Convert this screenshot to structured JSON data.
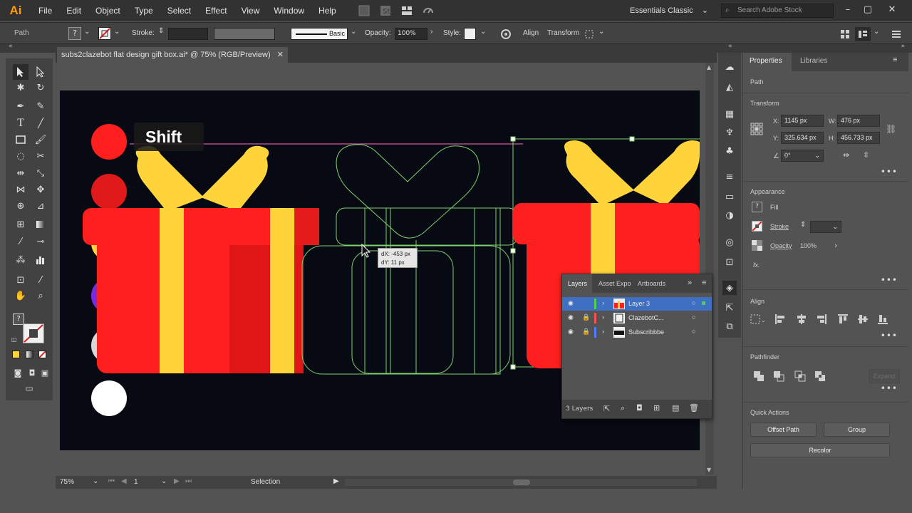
{
  "app": {
    "logo": "Ai"
  },
  "menu": [
    "File",
    "Edit",
    "Object",
    "Type",
    "Select",
    "Effect",
    "View",
    "Window",
    "Help"
  ],
  "workspace": "Essentials Classic",
  "stock_search": {
    "placeholder": "Search Adobe Stock"
  },
  "control_bar": {
    "selection_type": "Path",
    "stroke_label": "Stroke:",
    "brush_label": "Basic",
    "opacity_label": "Opacity:",
    "opacity_value": "100%",
    "style_label": "Style:",
    "align_label": "Align",
    "transform_label": "Transform"
  },
  "document_tab": {
    "title": "subs2clazebot flat design gift box.ai* @ 75% (RGB/Preview)"
  },
  "canvas": {
    "key_hint": "Shift",
    "move_dx": "dX: -453 px",
    "move_dy": "dY: 11 px"
  },
  "status_bar": {
    "zoom": "75%",
    "artboard": "1",
    "tool": "Selection"
  },
  "properties": {
    "tabs": [
      "Properties",
      "Libraries"
    ],
    "selection": "Path",
    "transform": {
      "title": "Transform",
      "x_label": "X:",
      "x": "1145 px",
      "y_label": "Y:",
      "y": "325.634 px",
      "w_label": "W:",
      "w": "476 px",
      "h_label": "H:",
      "h": "456.733 px",
      "angle": "0°"
    },
    "appearance": {
      "title": "Appearance",
      "fill_label": "Fill",
      "stroke_label": "Stroke",
      "opacity_label": "Opacity",
      "opacity_value": "100%",
      "fx_label": "fx."
    },
    "align_title": "Align",
    "pathfinder": {
      "title": "Pathfinder",
      "expand": "Expand"
    },
    "quick_actions": {
      "title": "Quick Actions",
      "offset_path": "Offset Path",
      "group": "Group",
      "recolor": "Recolor"
    }
  },
  "layers_panel": {
    "tabs": [
      "Layers",
      "Asset Expo",
      "Artboards"
    ],
    "layers": [
      {
        "name": "Layer 3",
        "color": "#4fd34f"
      },
      {
        "name": "ClazebotC...",
        "color": "#ff4f4f"
      },
      {
        "name": "Subscribbbe",
        "color": "#4f7fff"
      }
    ],
    "count": "3 Layers"
  },
  "colors": {
    "accent_red": "#ff1f1f",
    "ribbon_yellow": "#ffd43b",
    "selection_green": "#7cd36b",
    "artboard_bg": "#070913"
  }
}
